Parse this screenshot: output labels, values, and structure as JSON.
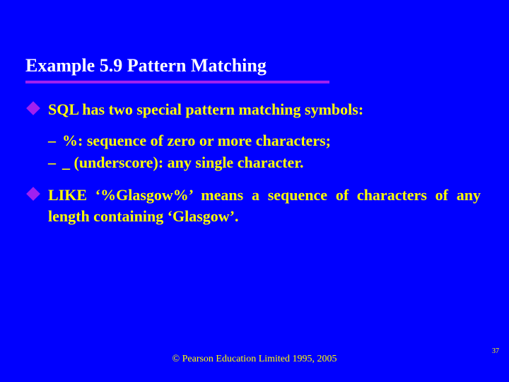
{
  "title": "Example 5.9  Pattern Matching",
  "bullets": {
    "b1": "SQL has two special pattern matching symbols:",
    "sub1": "%: sequence of zero or more characters;",
    "sub2": "_ (underscore): any single character.",
    "b2": "LIKE ‘%Glasgow%’ means a sequence of characters of any length containing ‘Glasgow’."
  },
  "footer": "© Pearson Education Limited 1995, 2005",
  "page": "37"
}
